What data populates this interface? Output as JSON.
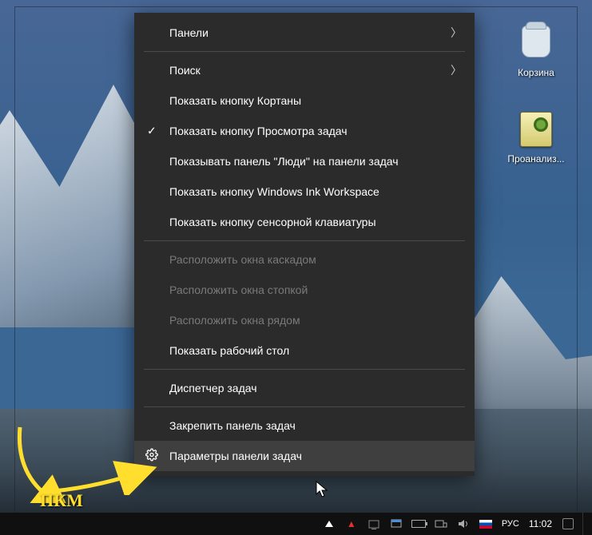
{
  "desktop": {
    "icons": [
      {
        "label": "Корзина"
      },
      {
        "label": "Проанализ..."
      }
    ]
  },
  "menu": {
    "items": [
      {
        "label": "Панели",
        "submenu": true
      },
      {
        "sep": true
      },
      {
        "label": "Поиск",
        "submenu": true
      },
      {
        "label": "Показать кнопку Кортаны"
      },
      {
        "label": "Показать кнопку Просмотра задач",
        "checked": true
      },
      {
        "label": "Показывать панель \"Люди\" на панели задач"
      },
      {
        "label": "Показать кнопку Windows Ink Workspace"
      },
      {
        "label": "Показать кнопку сенсорной клавиатуры"
      },
      {
        "sep": true
      },
      {
        "label": "Расположить окна каскадом",
        "disabled": true
      },
      {
        "label": "Расположить окна стопкой",
        "disabled": true
      },
      {
        "label": "Расположить окна рядом",
        "disabled": true
      },
      {
        "label": "Показать рабочий стол"
      },
      {
        "sep": true
      },
      {
        "label": "Диспетчер задач"
      },
      {
        "sep": true
      },
      {
        "label": "Закрепить панель задач"
      },
      {
        "label": "Параметры панели задач",
        "icon": "gear",
        "hover": true
      }
    ]
  },
  "annotation": {
    "pkm_label": "ПКМ"
  },
  "taskbar": {
    "lang": "РУС",
    "time": "11:02"
  }
}
